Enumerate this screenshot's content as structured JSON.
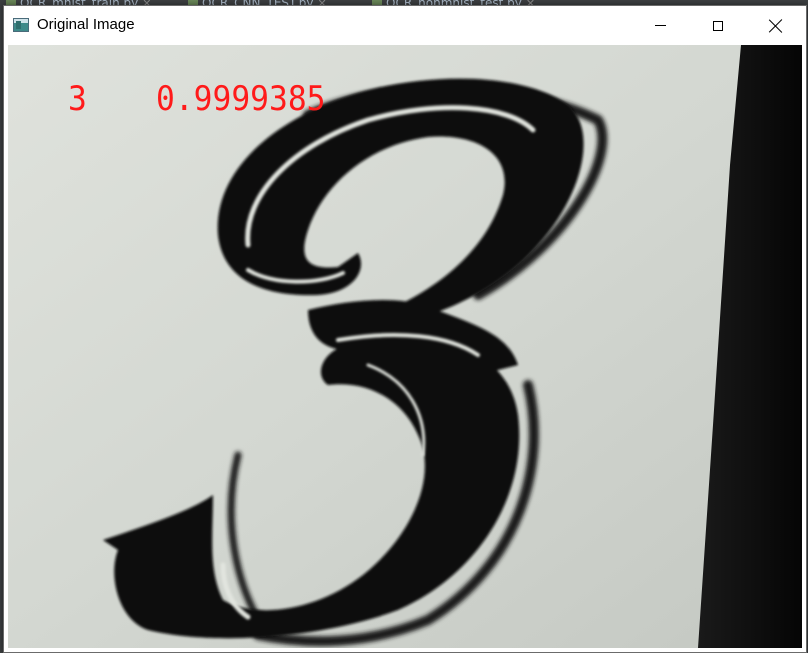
{
  "window": {
    "title": "Original Image",
    "app_icon": "window-image-icon",
    "controls": {
      "minimize": "minimize-icon",
      "maximize": "maximize-icon",
      "close": "close-icon"
    }
  },
  "background_tabs": [
    {
      "label": "OCR_mnist_train.py"
    },
    {
      "label": "OCR_CNN_TEST.py"
    },
    {
      "label": "OCR_nonmnist_test.py"
    }
  ],
  "image": {
    "subject": "handwritten-style digit three on paper",
    "prediction": {
      "digit": "3",
      "score": "0.9999385",
      "color": "#ff1a1a"
    }
  }
}
